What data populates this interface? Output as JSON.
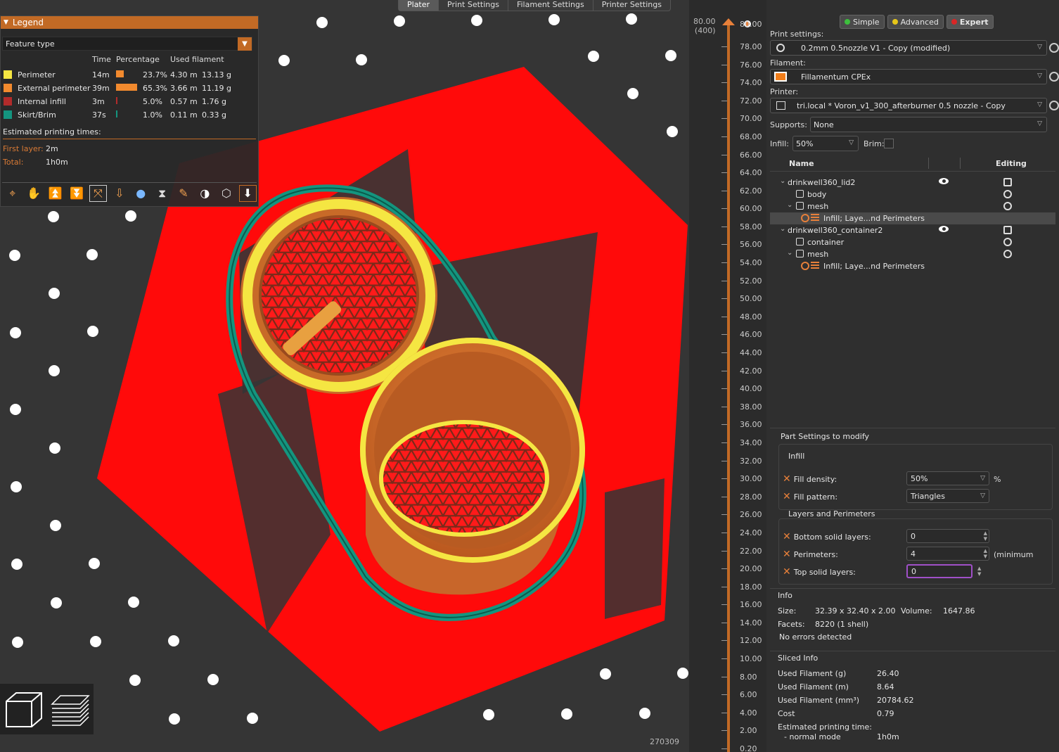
{
  "tabs": [
    {
      "label": "Plater"
    },
    {
      "label": "Print Settings"
    },
    {
      "label": "Filament Settings"
    },
    {
      "label": "Printer Settings"
    }
  ],
  "legend": {
    "title": "Legend",
    "view_type": "Feature type",
    "headers": {
      "time": "Time",
      "percentage": "Percentage",
      "used_filament": "Used filament"
    },
    "rows": [
      {
        "name": "Perimeter",
        "time": "14m",
        "percent": "23.7%",
        "length": "4.30 m",
        "weight": "13.13 g",
        "color": "#f5e642",
        "fraction": 0.237
      },
      {
        "name": "External perimeter",
        "time": "39m",
        "percent": "65.3%",
        "length": "3.66 m",
        "weight": "11.19 g",
        "color": "#f28a2e",
        "fraction": 0.653
      },
      {
        "name": "Internal infill",
        "time": "3m",
        "percent": "5.0%",
        "length": "0.57 m",
        "weight": "1.76 g",
        "color": "#b22b2b",
        "fraction": 0.05
      },
      {
        "name": "Skirt/Brim",
        "time": "37s",
        "percent": "1.0%",
        "length": "0.11 m",
        "weight": "0.33 g",
        "color": "#14957f",
        "fraction": 0.01
      }
    ],
    "estimated_label": "Estimated printing times:",
    "first_layer_label": "First layer:",
    "first_layer_value": "2m",
    "total_label": "Total:",
    "total_value": "1h0m"
  },
  "viewport": {
    "object_id": "270309"
  },
  "layer_slider": {
    "top_value": "80.00",
    "top_layer": "(400)",
    "top_right": "80.00",
    "ticks": [
      "78.00",
      "76.00",
      "74.00",
      "72.00",
      "70.00",
      "68.00",
      "66.00",
      "64.00",
      "62.00",
      "60.00",
      "58.00",
      "56.00",
      "54.00",
      "52.00",
      "50.00",
      "48.00",
      "46.00",
      "44.00",
      "42.00",
      "40.00",
      "38.00",
      "36.00",
      "34.00",
      "32.00",
      "30.00",
      "28.00",
      "26.00",
      "24.00",
      "22.00",
      "20.00",
      "18.00",
      "16.00",
      "14.00",
      "12.00",
      "10.00",
      "8.00",
      "6.00",
      "4.00",
      "2.00",
      "0.20"
    ]
  },
  "modes": [
    {
      "label": "Simple",
      "color": "#3dbf3d"
    },
    {
      "label": "Advanced",
      "color": "#e6c619"
    },
    {
      "label": "Expert",
      "color": "#d92626"
    }
  ],
  "print_settings": {
    "label": "Print settings:",
    "value": "0.2mm 0.5nozzle V1 - Copy (modified)"
  },
  "filament": {
    "label": "Filament:",
    "value": "Fillamentum CPEx",
    "color": "#f07d1a"
  },
  "printer": {
    "label": "Printer:",
    "value": "tri.local * Voron_v1_300_afterburner 0.5 nozzle - Copy"
  },
  "supports": {
    "label": "Supports:",
    "value": "None"
  },
  "infill": {
    "label": "Infill:",
    "value": "50%"
  },
  "brim": {
    "label": "Brim:"
  },
  "object_list": {
    "col_name": "Name",
    "col_editing": "Editing",
    "items": [
      {
        "label": "drinkwell360_lid2"
      },
      {
        "label": "body"
      },
      {
        "label": "mesh"
      },
      {
        "label": "Infill; Laye...nd Perimeters"
      },
      {
        "label": "drinkwell360_container2"
      },
      {
        "label": "container"
      },
      {
        "label": "mesh"
      },
      {
        "label": "Infill; Laye...nd Perimeters"
      }
    ]
  },
  "part_settings": {
    "title": "Part Settings to modify",
    "infill_group": "Infill",
    "fill_density_label": "Fill density:",
    "fill_density_value": "50%",
    "fill_density_unit": "%",
    "fill_pattern_label": "Fill pattern:",
    "fill_pattern_value": "Triangles",
    "layers_group": "Layers and Perimeters",
    "bottom_label": "Bottom solid layers:",
    "bottom_value": "0",
    "perimeters_label": "Perimeters:",
    "perimeters_value": "4",
    "perimeters_unit": "(minimum",
    "top_label": "Top solid layers:",
    "top_value": "0"
  },
  "info": {
    "title": "Info",
    "size_label": "Size:",
    "size_value": "32.39 x 32.40 x 2.00",
    "volume_label": "Volume:",
    "volume_value": "1647.86",
    "facets_label": "Facets:",
    "facets_value": "8220 (1 shell)",
    "errors": "No errors detected"
  },
  "sliced_info": {
    "title": "Sliced Info",
    "rows": [
      {
        "label": "Used Filament (g)",
        "value": "26.40"
      },
      {
        "label": "Used Filament (m)",
        "value": "8.64"
      },
      {
        "label": "Used Filament (mm³)",
        "value": "20784.62"
      },
      {
        "label": "Cost",
        "value": "0.79"
      }
    ],
    "est_label": "Estimated printing time:",
    "mode_label": "- normal mode",
    "mode_value": "1h0m"
  }
}
